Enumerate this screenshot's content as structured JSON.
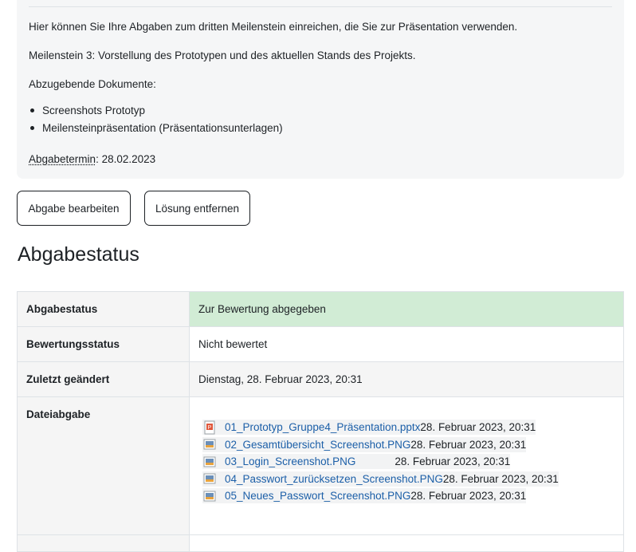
{
  "intro": {
    "line1": "Hier können Sie Ihre Abgaben zum dritten Meilenstein einreichen, die Sie zur Präsentation verwenden.",
    "line2": "Meilenstein 3: Vorstellung des Prototypen und des aktuellen Stands des Projekts.",
    "documents_label": "Abzugebende Dokumente:",
    "documents": [
      "Screenshots Prototyp",
      "Meilensteinpräsentation (Präsentationsunterlagen)"
    ],
    "deadline_label": "Abgabetermin",
    "deadline_value": ": 28.02.2023"
  },
  "buttons": {
    "edit": "Abgabe bearbeiten",
    "remove": "Lösung entfernen"
  },
  "heading": "Abgabestatus",
  "status_table": {
    "rows": [
      {
        "label": "Abgabestatus",
        "value": "Zur Bewertung abgegeben"
      },
      {
        "label": "Bewertungsstatus",
        "value": "Nicht bewertet"
      },
      {
        "label": "Zuletzt geändert",
        "value": "Dienstag, 28. Februar 2023, 20:31"
      },
      {
        "label": "Dateiabgabe",
        "value": ""
      }
    ],
    "status_color": "#d1ecd5"
  },
  "files": [
    {
      "name": "01_Prototyp_Gruppe4_Präsentation.pptx",
      "date": "28. Februar 2023, 20:31",
      "icon": "powerpoint-file-icon"
    },
    {
      "name": "02_Gesamtübersicht_Screenshot.PNG",
      "date": "28. Februar 2023, 20:31",
      "icon": "image-file-icon"
    },
    {
      "name": "03_Login_Screenshot.PNG",
      "date": "28. Februar 2023, 20:31",
      "icon": "image-file-icon"
    },
    {
      "name": "04_Passwort_zurücksetzen_Screenshot.PNG",
      "date": "28. Februar 2023, 20:31",
      "icon": "image-file-icon"
    },
    {
      "name": "05_Neues_Passwort_Screenshot.PNG",
      "date": "28. Februar 2023, 20:31",
      "icon": "image-file-icon"
    }
  ]
}
